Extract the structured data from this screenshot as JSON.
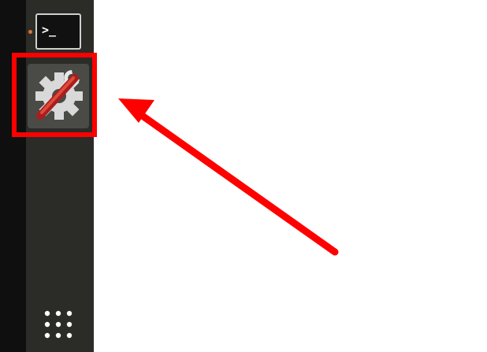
{
  "launcher": {
    "items": [
      {
        "name": "terminal",
        "icon": "terminal-icon",
        "glyph": ">_"
      },
      {
        "name": "system-settings",
        "icon": "settings-wrench-gear-icon"
      }
    ],
    "show_apps_icon": "app-grid-icon"
  },
  "annotation": {
    "highlight_color": "#ff0000",
    "arrow_color": "#ff0000"
  },
  "colors": {
    "dock_bg": "#2b2b28",
    "running_dot": "#e0703a"
  }
}
